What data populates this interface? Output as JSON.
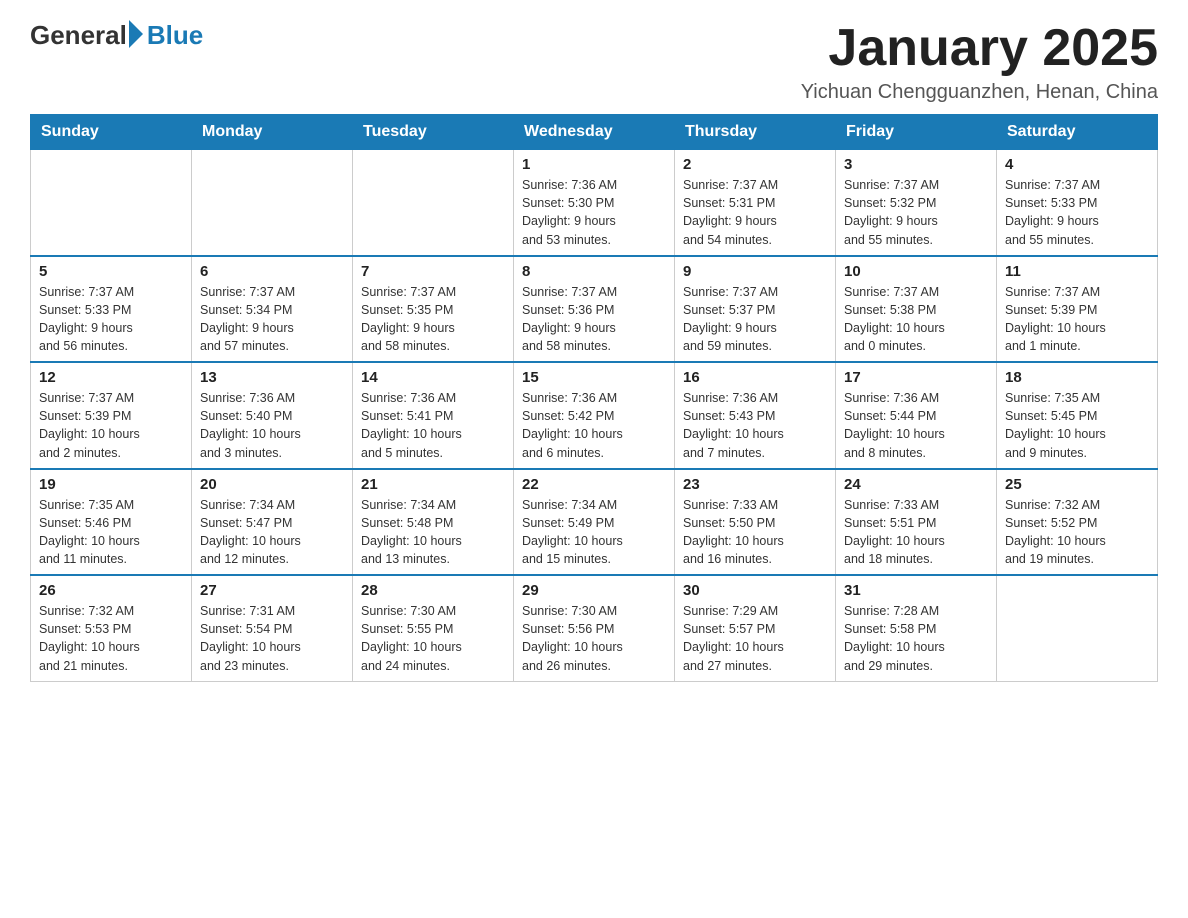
{
  "logo": {
    "general": "General",
    "blue": "Blue"
  },
  "title": "January 2025",
  "subtitle": "Yichuan Chengguanzhen, Henan, China",
  "days_of_week": [
    "Sunday",
    "Monday",
    "Tuesday",
    "Wednesday",
    "Thursday",
    "Friday",
    "Saturday"
  ],
  "weeks": [
    [
      {
        "day": "",
        "info": ""
      },
      {
        "day": "",
        "info": ""
      },
      {
        "day": "",
        "info": ""
      },
      {
        "day": "1",
        "info": "Sunrise: 7:36 AM\nSunset: 5:30 PM\nDaylight: 9 hours\nand 53 minutes."
      },
      {
        "day": "2",
        "info": "Sunrise: 7:37 AM\nSunset: 5:31 PM\nDaylight: 9 hours\nand 54 minutes."
      },
      {
        "day": "3",
        "info": "Sunrise: 7:37 AM\nSunset: 5:32 PM\nDaylight: 9 hours\nand 55 minutes."
      },
      {
        "day": "4",
        "info": "Sunrise: 7:37 AM\nSunset: 5:33 PM\nDaylight: 9 hours\nand 55 minutes."
      }
    ],
    [
      {
        "day": "5",
        "info": "Sunrise: 7:37 AM\nSunset: 5:33 PM\nDaylight: 9 hours\nand 56 minutes."
      },
      {
        "day": "6",
        "info": "Sunrise: 7:37 AM\nSunset: 5:34 PM\nDaylight: 9 hours\nand 57 minutes."
      },
      {
        "day": "7",
        "info": "Sunrise: 7:37 AM\nSunset: 5:35 PM\nDaylight: 9 hours\nand 58 minutes."
      },
      {
        "day": "8",
        "info": "Sunrise: 7:37 AM\nSunset: 5:36 PM\nDaylight: 9 hours\nand 58 minutes."
      },
      {
        "day": "9",
        "info": "Sunrise: 7:37 AM\nSunset: 5:37 PM\nDaylight: 9 hours\nand 59 minutes."
      },
      {
        "day": "10",
        "info": "Sunrise: 7:37 AM\nSunset: 5:38 PM\nDaylight: 10 hours\nand 0 minutes."
      },
      {
        "day": "11",
        "info": "Sunrise: 7:37 AM\nSunset: 5:39 PM\nDaylight: 10 hours\nand 1 minute."
      }
    ],
    [
      {
        "day": "12",
        "info": "Sunrise: 7:37 AM\nSunset: 5:39 PM\nDaylight: 10 hours\nand 2 minutes."
      },
      {
        "day": "13",
        "info": "Sunrise: 7:36 AM\nSunset: 5:40 PM\nDaylight: 10 hours\nand 3 minutes."
      },
      {
        "day": "14",
        "info": "Sunrise: 7:36 AM\nSunset: 5:41 PM\nDaylight: 10 hours\nand 5 minutes."
      },
      {
        "day": "15",
        "info": "Sunrise: 7:36 AM\nSunset: 5:42 PM\nDaylight: 10 hours\nand 6 minutes."
      },
      {
        "day": "16",
        "info": "Sunrise: 7:36 AM\nSunset: 5:43 PM\nDaylight: 10 hours\nand 7 minutes."
      },
      {
        "day": "17",
        "info": "Sunrise: 7:36 AM\nSunset: 5:44 PM\nDaylight: 10 hours\nand 8 minutes."
      },
      {
        "day": "18",
        "info": "Sunrise: 7:35 AM\nSunset: 5:45 PM\nDaylight: 10 hours\nand 9 minutes."
      }
    ],
    [
      {
        "day": "19",
        "info": "Sunrise: 7:35 AM\nSunset: 5:46 PM\nDaylight: 10 hours\nand 11 minutes."
      },
      {
        "day": "20",
        "info": "Sunrise: 7:34 AM\nSunset: 5:47 PM\nDaylight: 10 hours\nand 12 minutes."
      },
      {
        "day": "21",
        "info": "Sunrise: 7:34 AM\nSunset: 5:48 PM\nDaylight: 10 hours\nand 13 minutes."
      },
      {
        "day": "22",
        "info": "Sunrise: 7:34 AM\nSunset: 5:49 PM\nDaylight: 10 hours\nand 15 minutes."
      },
      {
        "day": "23",
        "info": "Sunrise: 7:33 AM\nSunset: 5:50 PM\nDaylight: 10 hours\nand 16 minutes."
      },
      {
        "day": "24",
        "info": "Sunrise: 7:33 AM\nSunset: 5:51 PM\nDaylight: 10 hours\nand 18 minutes."
      },
      {
        "day": "25",
        "info": "Sunrise: 7:32 AM\nSunset: 5:52 PM\nDaylight: 10 hours\nand 19 minutes."
      }
    ],
    [
      {
        "day": "26",
        "info": "Sunrise: 7:32 AM\nSunset: 5:53 PM\nDaylight: 10 hours\nand 21 minutes."
      },
      {
        "day": "27",
        "info": "Sunrise: 7:31 AM\nSunset: 5:54 PM\nDaylight: 10 hours\nand 23 minutes."
      },
      {
        "day": "28",
        "info": "Sunrise: 7:30 AM\nSunset: 5:55 PM\nDaylight: 10 hours\nand 24 minutes."
      },
      {
        "day": "29",
        "info": "Sunrise: 7:30 AM\nSunset: 5:56 PM\nDaylight: 10 hours\nand 26 minutes."
      },
      {
        "day": "30",
        "info": "Sunrise: 7:29 AM\nSunset: 5:57 PM\nDaylight: 10 hours\nand 27 minutes."
      },
      {
        "day": "31",
        "info": "Sunrise: 7:28 AM\nSunset: 5:58 PM\nDaylight: 10 hours\nand 29 minutes."
      },
      {
        "day": "",
        "info": ""
      }
    ]
  ]
}
